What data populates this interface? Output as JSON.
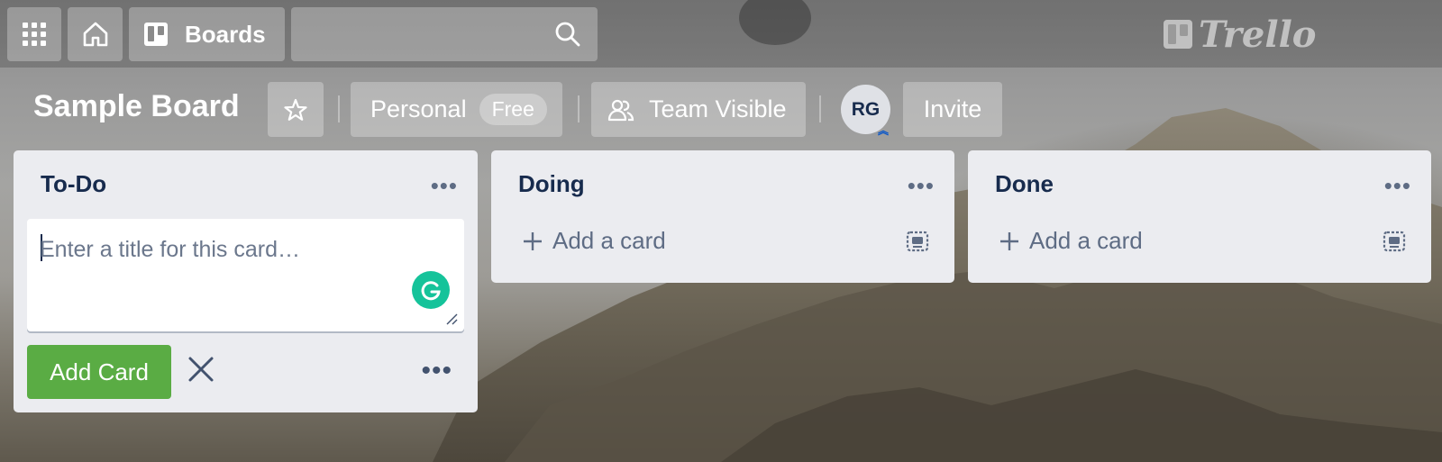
{
  "topbar": {
    "boards_label": "Boards",
    "search_placeholder": "",
    "brand": "Trello"
  },
  "board": {
    "title": "Sample Board",
    "visibility_personal": "Personal",
    "plan_badge": "Free",
    "team_visibility": "Team Visible",
    "member_initials": "RG",
    "invite_label": "Invite"
  },
  "lists": [
    {
      "title": "To-Do",
      "composer": {
        "placeholder": "Enter a title for this card…",
        "value": "",
        "add_button": "Add Card"
      }
    },
    {
      "title": "Doing",
      "add_card_label": "Add a card"
    },
    {
      "title": "Done",
      "add_card_label": "Add a card"
    }
  ],
  "colors": {
    "add_button": "#5aac44",
    "list_bg": "#ebecf0",
    "text_dark": "#172b4d",
    "grammarly": "#15c39a"
  },
  "icons": [
    "apps-grid-icon",
    "home-icon",
    "boards-icon",
    "search-icon",
    "trello-logo-icon",
    "star-icon",
    "team-icon",
    "close-icon",
    "plus-icon",
    "card-template-icon",
    "grammarly-icon",
    "resize-handle-icon"
  ]
}
